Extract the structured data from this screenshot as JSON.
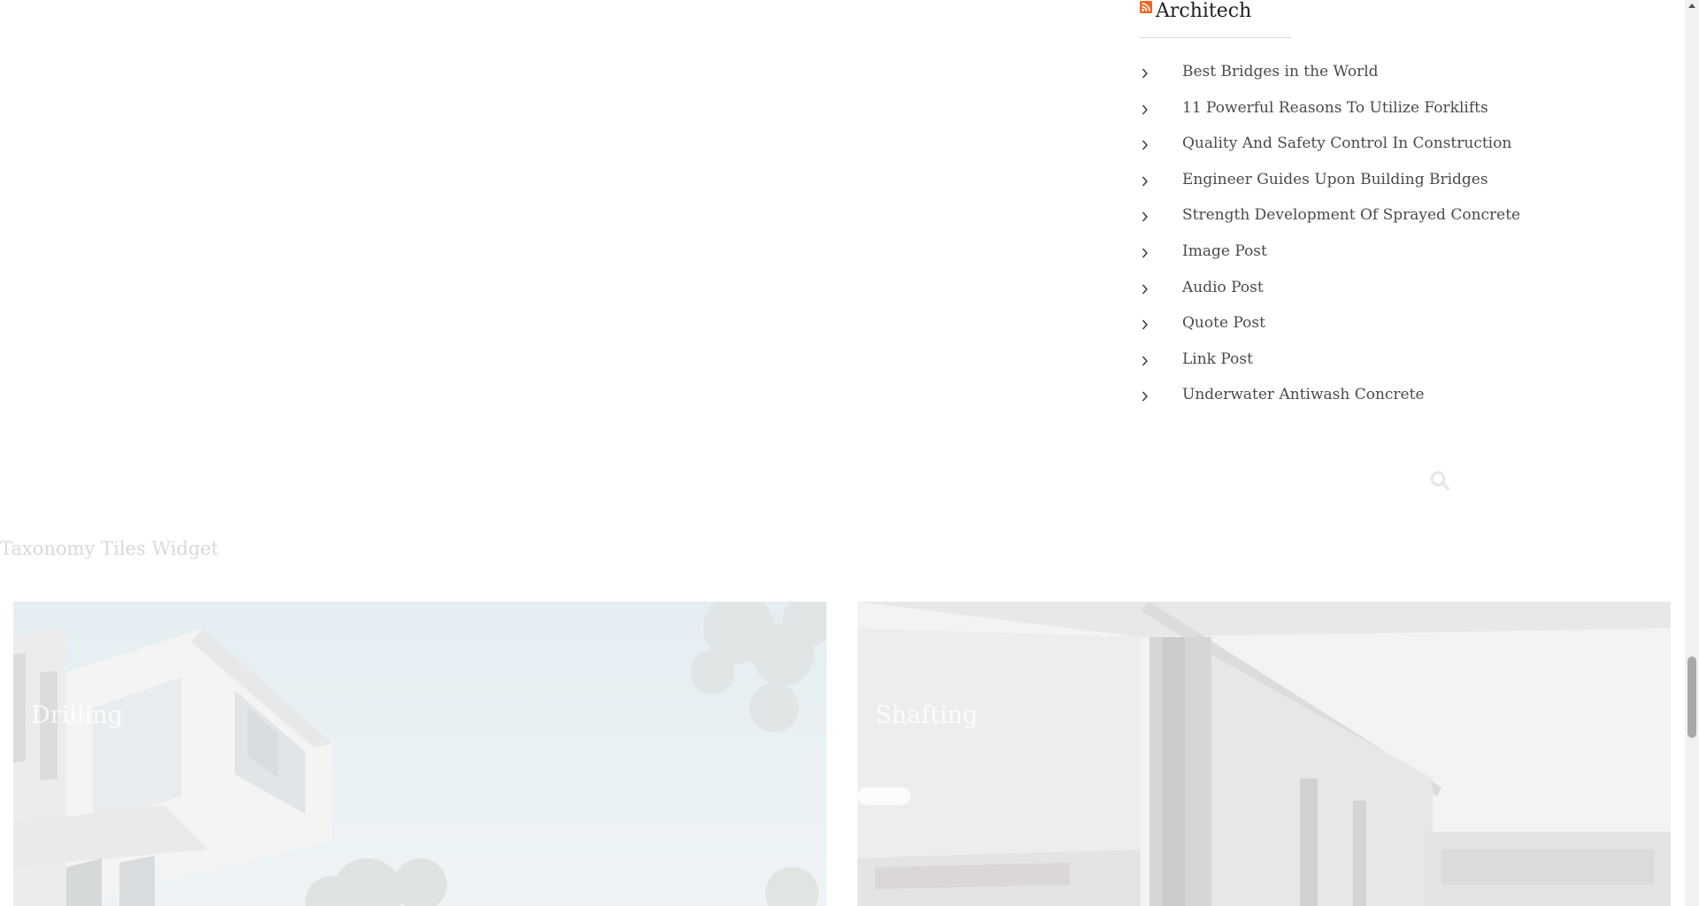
{
  "rss_widget": {
    "title": "Architech",
    "items": [
      "Best Bridges in the World",
      "11 Powerful Reasons To Utilize Forklifts",
      "Quality And Safety Control In Construction",
      "Engineer Guides Upon Building Bridges",
      "Strength Development Of Sprayed Concrete",
      "Image Post",
      "Audio Post",
      "Quote Post",
      "Link Post",
      "Underwater Antiwash Concrete"
    ]
  },
  "search": {
    "icon": "search-icon"
  },
  "taxonomy": {
    "title": "Taxonomy Tiles Widget",
    "tiles": [
      "Drilling",
      "Shafting"
    ]
  },
  "colors": {
    "rss_orange": "#f26522",
    "title_text": "#1f1f1f",
    "link_text": "#4a4a4a",
    "faded_text": "#d7dadd"
  }
}
